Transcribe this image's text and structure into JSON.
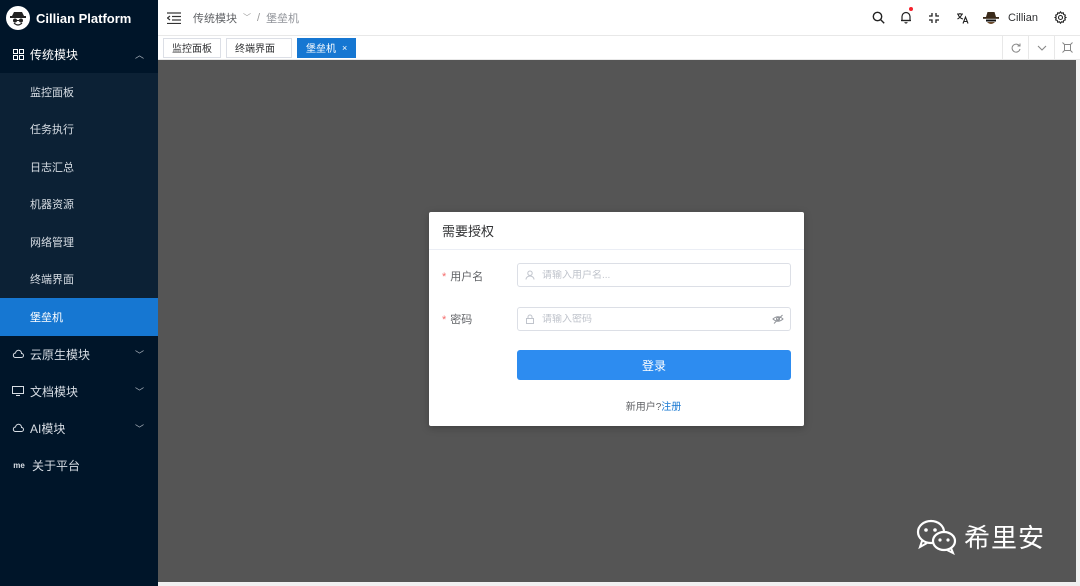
{
  "app": {
    "title": "Cillian Platform"
  },
  "sidebar": {
    "groups": [
      {
        "label": "传统模块",
        "icon": "grid-icon",
        "expanded": true,
        "items": [
          "监控面板",
          "任务执行",
          "日志汇总",
          "机器资源",
          "网络管理",
          "终端界面",
          "堡垒机"
        ],
        "active_item": "堡垒机"
      },
      {
        "label": "云原生模块",
        "icon": "cloud-icon"
      },
      {
        "label": "文档模块",
        "icon": "monitor-icon"
      },
      {
        "label": "AI模块",
        "icon": "cloud-icon"
      },
      {
        "label": "关于平台",
        "icon": "me-icon",
        "icon_text": "me"
      }
    ]
  },
  "header": {
    "breadcrumb": [
      "传统模块",
      "堡垒机"
    ],
    "separator": "/",
    "user_name": "Cillian",
    "icons": [
      "search-icon",
      "bell-icon",
      "fullscreen-icon",
      "translate-icon",
      "avatar",
      "settings-icon"
    ]
  },
  "tabs": {
    "items": [
      "监控面板",
      "终端界面",
      "堡垒机"
    ],
    "active": "堡垒机",
    "close_glyph": "×"
  },
  "dialog": {
    "title": "需要授权",
    "username_label": "用户名",
    "username_placeholder": "请输入用户名...",
    "password_label": "密码",
    "password_placeholder": "请输入密码",
    "required_mark": "*",
    "login_label": "登录",
    "register_prompt": "新用户?",
    "register_link": "注册"
  },
  "watermark": {
    "text": "希里安"
  },
  "colors": {
    "sidebar_bg": "#001529",
    "active_blue": "#1677d2",
    "button_blue": "#2d8cf0",
    "overlay_gray": "#555555",
    "notification_dot": "#f5222d"
  }
}
